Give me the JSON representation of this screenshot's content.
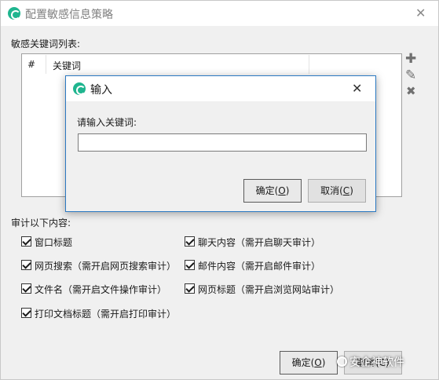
{
  "window": {
    "title": "配置敏感信息策略",
    "close_glyph": "✕"
  },
  "keyword_list": {
    "label": "敏感关键词列表:",
    "columns": [
      "#",
      "关键词"
    ]
  },
  "side_toolbar": {
    "add_glyph": "✚",
    "edit_glyph": "✎",
    "delete_glyph": "✖"
  },
  "audit": {
    "label": "审计以下内容:",
    "options": [
      {
        "label": "窗口标题",
        "checked": true
      },
      {
        "label": "聊天内容（需开启聊天审计）",
        "checked": true
      },
      {
        "label": "网页搜索（需开启网页搜索审计）",
        "checked": true
      },
      {
        "label": "邮件内容（需开启邮件审计）",
        "checked": true
      },
      {
        "label": "文件名（需开启文件操作审计）",
        "checked": true
      },
      {
        "label": "网页标题（需开启浏览网站审计）",
        "checked": true
      },
      {
        "label": "打印文档标题（需开启打印审计）",
        "checked": true
      }
    ]
  },
  "footer": {
    "ok_label": "确定(",
    "ok_key": "O",
    "ok_tail": ")",
    "cancel_label": "取消(C)"
  },
  "input_dialog": {
    "title": "输入",
    "close_glyph": "✕",
    "prompt": "请输入关键词:",
    "value": "",
    "ok_label": "确定(",
    "ok_key": "O",
    "ok_tail": ")",
    "cancel_label": "取消(",
    "cancel_key": "C",
    "cancel_tail": ")"
  },
  "watermark": {
    "text": "安企神软件"
  },
  "colors": {
    "app_icon": "#1fb58f",
    "dialog_border": "#2b79c2",
    "window_bg": "#f0f0f0"
  }
}
